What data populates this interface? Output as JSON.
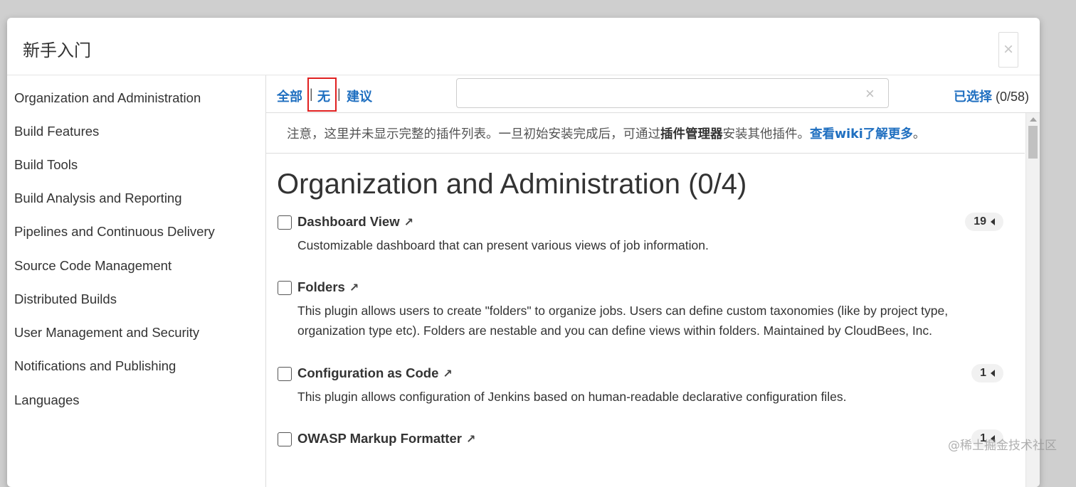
{
  "dialog": {
    "title": "新手入门",
    "close_glyph": "×"
  },
  "sidebar": {
    "items": [
      {
        "label": "Organization and Administration"
      },
      {
        "label": "Build Features"
      },
      {
        "label": "Build Tools"
      },
      {
        "label": "Build Analysis and Reporting"
      },
      {
        "label": "Pipelines and Continuous Delivery"
      },
      {
        "label": "Source Code Management"
      },
      {
        "label": "Distributed Builds"
      },
      {
        "label": "User Management and Security"
      },
      {
        "label": "Notifications and Publishing"
      },
      {
        "label": "Languages"
      }
    ]
  },
  "filters": {
    "all_label": "全部",
    "none_label": "无",
    "suggested_label": "建议",
    "separator": "|"
  },
  "search": {
    "value": "",
    "placeholder": "",
    "clear_glyph": "×"
  },
  "selection": {
    "label": "已选择",
    "count": "(0/58)"
  },
  "notice": {
    "text": "注意，这里并未显示完整的插件列表。一旦初始安装完成后，可通过",
    "plugin_manager": "插件管理器",
    "text2": "安装其他插件。",
    "wiki_link": "查看wiki了解更多",
    "end": "。"
  },
  "category": {
    "title": "Organization and Administration (0/4)"
  },
  "plugins": [
    {
      "name": "Dashboard View",
      "ext_glyph": "↗",
      "description": "Customizable dashboard that can present various views of job information.",
      "dependencies": "19",
      "checked": false
    },
    {
      "name": "Folders",
      "ext_glyph": "↗",
      "description": "This plugin allows users to create \"folders\" to organize jobs. Users can define custom taxonomies (like by project type, organization type etc). Folders are nestable and you can define views within folders. Maintained by CloudBees, Inc.",
      "dependencies": "",
      "checked": false
    },
    {
      "name": "Configuration as Code",
      "ext_glyph": "↗",
      "description": "This plugin allows configuration of Jenkins based on human-readable declarative configuration files.",
      "dependencies": "1",
      "checked": false
    },
    {
      "name": "OWASP Markup Formatter",
      "ext_glyph": "↗",
      "description": "",
      "dependencies": "1",
      "checked": false
    }
  ],
  "watermark": "@稀土掘金技术社区",
  "colors": {
    "accent": "#1f6fc0",
    "highlight_box": "#e02020",
    "text": "#333333"
  }
}
